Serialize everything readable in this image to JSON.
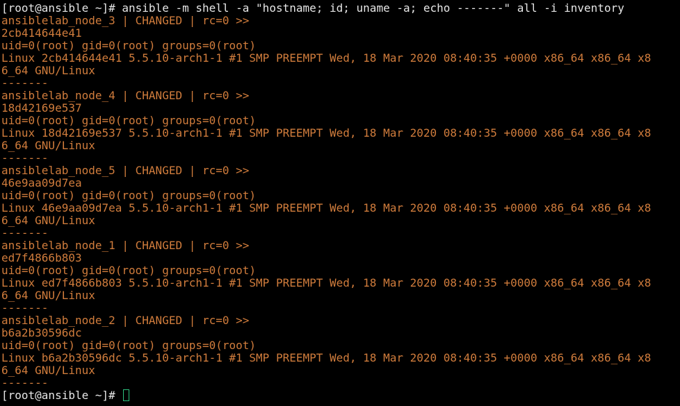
{
  "terminal": {
    "prompt": "[root@ansible ~]# ",
    "command": "ansible -m shell -a \"hostname; id; uname -a; echo -------\" all -i inventory",
    "hosts": [
      {
        "header": "ansiblelab_node_3 | CHANGED | rc=0 >>",
        "hostname": "2cb414644e41",
        "id": "uid=0(root) gid=0(root) groups=0(root)",
        "uname_1": "Linux 2cb414644e41 5.5.10-arch1-1 #1 SMP PREEMPT Wed, 18 Mar 2020 08:40:35 +0000 x86_64 x86_64 x8",
        "uname_2": "6_64 GNU/Linux",
        "sep": "-------"
      },
      {
        "header": "ansiblelab_node_4 | CHANGED | rc=0 >>",
        "hostname": "18d42169e537",
        "id": "uid=0(root) gid=0(root) groups=0(root)",
        "uname_1": "Linux 18d42169e537 5.5.10-arch1-1 #1 SMP PREEMPT Wed, 18 Mar 2020 08:40:35 +0000 x86_64 x86_64 x8",
        "uname_2": "6_64 GNU/Linux",
        "sep": "-------"
      },
      {
        "header": "ansiblelab_node_5 | CHANGED | rc=0 >>",
        "hostname": "46e9aa09d7ea",
        "id": "uid=0(root) gid=0(root) groups=0(root)",
        "uname_1": "Linux 46e9aa09d7ea 5.5.10-arch1-1 #1 SMP PREEMPT Wed, 18 Mar 2020 08:40:35 +0000 x86_64 x86_64 x8",
        "uname_2": "6_64 GNU/Linux",
        "sep": "-------"
      },
      {
        "header": "ansiblelab_node_1 | CHANGED | rc=0 >>",
        "hostname": "ed7f4866b803",
        "id": "uid=0(root) gid=0(root) groups=0(root)",
        "uname_1": "Linux ed7f4866b803 5.5.10-arch1-1 #1 SMP PREEMPT Wed, 18 Mar 2020 08:40:35 +0000 x86_64 x86_64 x8",
        "uname_2": "6_64 GNU/Linux",
        "sep": "-------"
      },
      {
        "header": "ansiblelab_node_2 | CHANGED | rc=0 >>",
        "hostname": "b6a2b30596dc",
        "id": "uid=0(root) gid=0(root) groups=0(root)",
        "uname_1": "Linux b6a2b30596dc 5.5.10-arch1-1 #1 SMP PREEMPT Wed, 18 Mar 2020 08:40:35 +0000 x86_64 x86_64 x8",
        "uname_2": "6_64 GNU/Linux",
        "sep": "-------"
      }
    ],
    "final_prompt": "[root@ansible ~]# "
  },
  "colors": {
    "background": "#000000",
    "prompt_text": "#e6e6e6",
    "output_text": "#d07c3c",
    "cursor": "#2ec27e"
  }
}
